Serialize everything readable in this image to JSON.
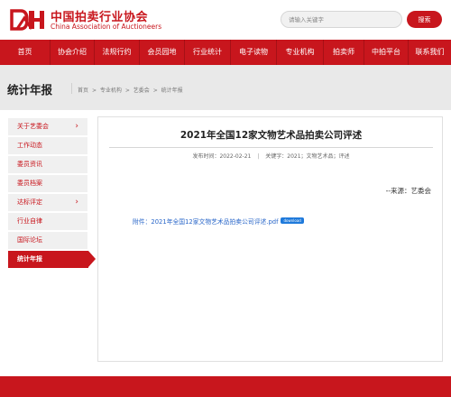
{
  "colors": {
    "brand_red": "#c8161d",
    "band_grey": "#e9e9e9",
    "link_blue": "#2a67c9"
  },
  "header": {
    "logo_icon": "cah-logo-icon",
    "logo_cn": "中国拍卖行业协会",
    "logo_en": "China Association of Auctioneers",
    "search_placeholder": "请输入关键字",
    "search_button": "搜索"
  },
  "nav": {
    "items": [
      "首页",
      "协会介绍",
      "法规行约",
      "会员园地",
      "行业统计",
      "电子读物",
      "专业机构",
      "拍卖师",
      "中拍平台",
      "联系我们"
    ]
  },
  "band": {
    "title": "统计年报",
    "breadcrumb": [
      "首页",
      ">",
      "专业机构",
      ">",
      "艺委会",
      ">",
      "统计年报"
    ]
  },
  "sidebar": {
    "items": [
      {
        "label": "关于艺委会",
        "chevron": "›",
        "active": false
      },
      {
        "label": "工作动态",
        "chevron": "",
        "active": false
      },
      {
        "label": "委员资讯",
        "chevron": "",
        "active": false
      },
      {
        "label": "委员档案",
        "chevron": "",
        "active": false
      },
      {
        "label": "达标评定",
        "chevron": "›",
        "active": false
      },
      {
        "label": "行业自律",
        "chevron": "",
        "active": false
      },
      {
        "label": "国际论坛",
        "chevron": "",
        "active": false
      },
      {
        "label": "统计年报",
        "chevron": "",
        "active": true
      }
    ]
  },
  "article": {
    "title": "2021年全国12家文物艺术品拍卖公司评述",
    "date_label": "发布时间：",
    "date": "2022-02-21",
    "separator": "|",
    "keywords_label": "关键字：",
    "keywords": "2021；文物艺术品；评述",
    "source": "--来源：艺委会",
    "attachment_label": "附件：",
    "attachment_file": "2021年全国12家文物艺术品拍卖公司评述.pdf",
    "download_badge": "download"
  }
}
